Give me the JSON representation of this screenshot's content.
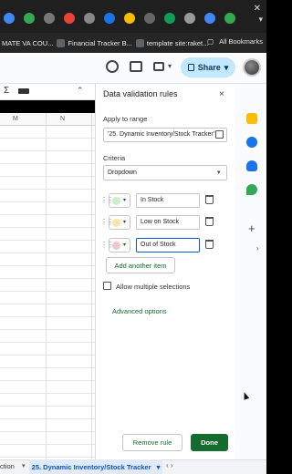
{
  "bookmarks": {
    "items": [
      "MATE VA COU...",
      "Financial Tracker B...",
      "template site:raket..."
    ],
    "all_label": "All Bookmarks"
  },
  "toolbar": {
    "share_label": "Share"
  },
  "grid": {
    "columns": [
      "M",
      "N"
    ],
    "sigma": "Σ"
  },
  "panel": {
    "title": "Data validation rules",
    "apply_label": "Apply to range",
    "range_value": "'25. Dynamic Inventory/Stock Tracker'",
    "criteria_label": "Criteria",
    "criteria_value": "Dropdown",
    "items": [
      {
        "value": "In Stock",
        "color": "#cdeccd"
      },
      {
        "value": "Low on Stock",
        "color": "#f8e6a6"
      },
      {
        "value": "Out of Stock",
        "color": "#f5c6c6"
      }
    ],
    "add_item_label": "Add another item",
    "multi_label": "Allow multiple selections",
    "advanced_label": "Advanced options",
    "remove_label": "Remove rule",
    "done_label": "Done"
  },
  "sheet_tabs": {
    "partial_label": "ction",
    "active_label": "25. Dynamic Inventory/Stock Tracker"
  },
  "icons": {
    "close": "×",
    "caret_down": "▾",
    "drag": "⋮⋮",
    "nav": "‹ ›"
  }
}
